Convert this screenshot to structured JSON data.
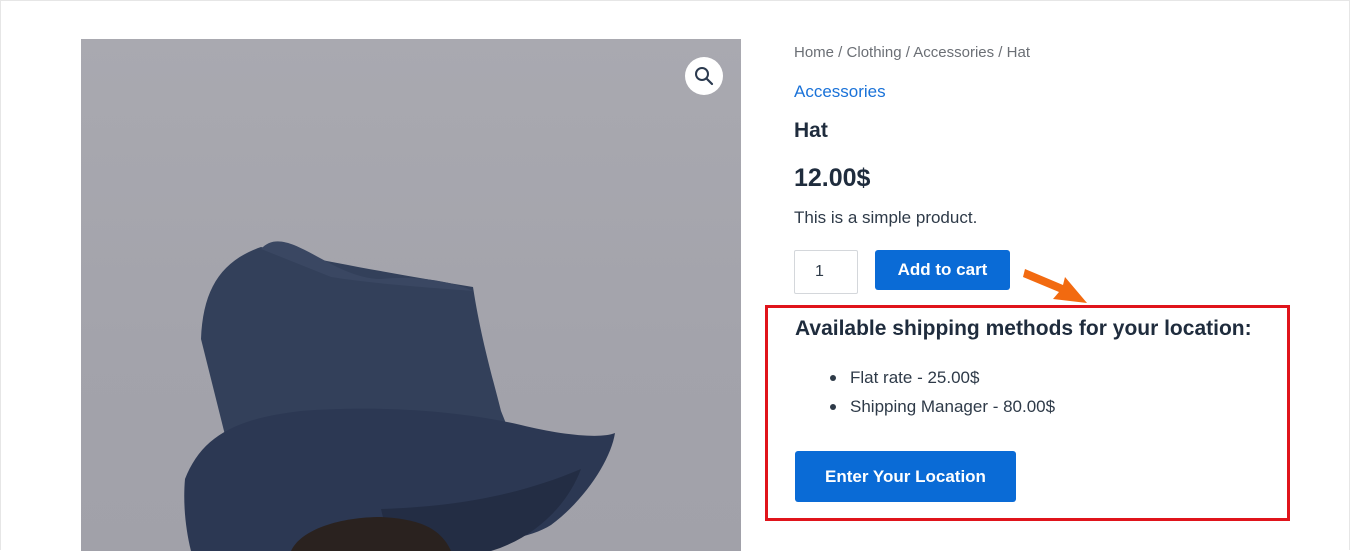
{
  "breadcrumb": {
    "items": [
      "Home",
      "Clothing",
      "Accessories",
      "Hat"
    ],
    "separator": " / "
  },
  "product": {
    "category": "Accessories",
    "title": "Hat",
    "price": "12.00$",
    "description": "This is a simple product.",
    "quantity": "1",
    "add_to_cart_label": "Add to cart"
  },
  "gallery": {
    "zoom_icon": "magnifier-icon",
    "image_subject": "person-wearing-navy-bucket-hat"
  },
  "shipping": {
    "title": "Available shipping methods for your location:",
    "methods": [
      "Flat rate - 25.00$",
      "Shipping Manager - 80.00$"
    ],
    "button_label": "Enter Your Location"
  },
  "colors": {
    "accent": "#0a6bd6",
    "highlight_border": "#e0141b",
    "annotation_arrow": "#f26a10",
    "hat": "#2f3c56"
  }
}
